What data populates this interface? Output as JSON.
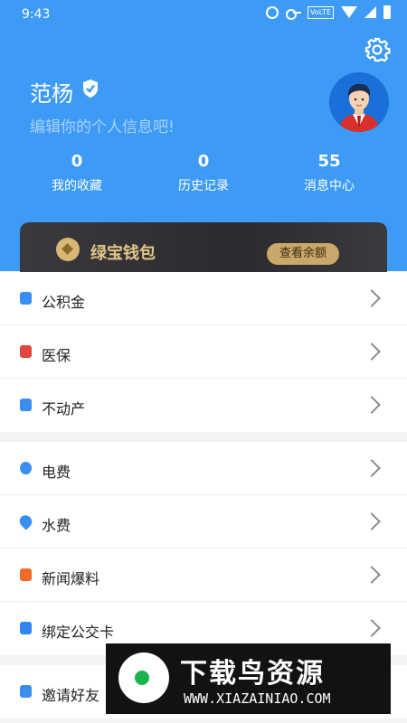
{
  "status_bar": {
    "time": "9:43",
    "volte": "VoLTE",
    "icons": [
      "alarm-icon",
      "key-icon",
      "volte-icon",
      "wifi-icon",
      "signal-icon",
      "battery-icon"
    ]
  },
  "profile": {
    "name": "范杨",
    "subtitle": "编辑你的个人信息吧!",
    "verified_icon": "shield-check-icon",
    "avatar_icon": "avatar-man-suit"
  },
  "settings_icon": "gear-icon",
  "stats": [
    {
      "value": "0",
      "label": "我的收藏"
    },
    {
      "value": "0",
      "label": "历史记录"
    },
    {
      "value": "55",
      "label": "消息中心"
    }
  ],
  "wallet": {
    "title": "绿宝钱包",
    "button": "查看余额"
  },
  "menu_groups": [
    [
      {
        "label": "公积金",
        "icon": "fund-icon",
        "color": "#3a8ef0"
      },
      {
        "label": "医保",
        "icon": "medical-icon",
        "color": "#e0473e"
      },
      {
        "label": "不动产",
        "icon": "building-icon",
        "color": "#3a8ef0"
      }
    ],
    [
      {
        "label": "电费",
        "icon": "bolt-icon",
        "color": "#3a8ef0"
      },
      {
        "label": "水费",
        "icon": "drop-icon",
        "color": "#3a8ef0"
      },
      {
        "label": "新闻爆料",
        "icon": "news-icon",
        "color": "#f06a2a"
      },
      {
        "label": "绑定公交卡",
        "icon": "card-icon",
        "color": "#2f86ee"
      }
    ],
    [
      {
        "label": "邀请好友",
        "icon": "invite-icon",
        "color": "#3a8ef0"
      }
    ]
  ],
  "watermark": {
    "title": "下载鸟资源",
    "url": "WWW.XIAZAINIAO.COM"
  },
  "colors": {
    "header": "#3d9bf5",
    "wallet_gold": "#e3c587"
  }
}
